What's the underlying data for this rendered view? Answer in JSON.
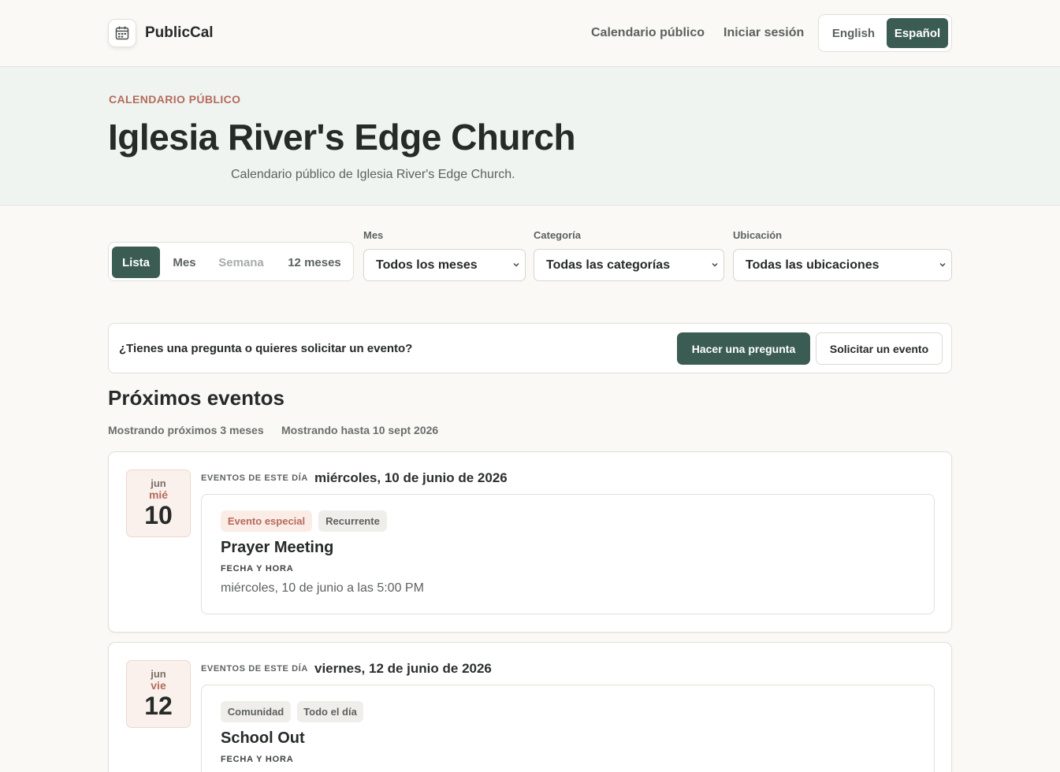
{
  "header": {
    "brand": "PublicCal",
    "nav": [
      "Calendario público",
      "Iniciar sesión"
    ],
    "languages": [
      "English",
      "Español"
    ],
    "active_language": "Español"
  },
  "hero": {
    "eyebrow": "CALENDARIO PÚBLICO",
    "title": "Iglesia River's Edge Church",
    "description": "Calendario público de Iglesia River's Edge Church."
  },
  "views": {
    "list": "Lista",
    "month": "Mes",
    "week": "Semana",
    "year": "12 meses",
    "active": "Lista"
  },
  "filters": {
    "month": {
      "label": "Mes",
      "value": "Todos los meses"
    },
    "category": {
      "label": "Categoría",
      "value": "Todas las categorías"
    },
    "location": {
      "label": "Ubicación",
      "value": "Todas las ubicaciones"
    }
  },
  "question_bar": {
    "text": "¿Tienes una pregunta o quieres solicitar un evento?",
    "ask_button": "Hacer una pregunta",
    "request_button": "Solicitar un evento"
  },
  "upcoming": {
    "title": "Próximos eventos",
    "range_note": "Mostrando próximos 3 meses",
    "until_note": "Mostrando hasta 10 sept 2026"
  },
  "days": [
    {
      "month": "jun",
      "weekday": "mié",
      "day": "10",
      "eyebrow": "EVENTOS DE ESTE DÍA",
      "date_long": "miércoles, 10 de junio de 2026",
      "event": {
        "tags": [
          "Evento especial",
          "Recurrente"
        ],
        "title": "Prayer Meeting",
        "datetime_label": "FECHA Y HORA",
        "datetime": "miércoles, 10 de junio a las 5:00 PM"
      }
    },
    {
      "month": "jun",
      "weekday": "vie",
      "day": "12",
      "eyebrow": "EVENTOS DE ESTE DÍA",
      "date_long": "viernes, 12 de junio de 2026",
      "event": {
        "tags": [
          "Comunidad",
          "Todo el día"
        ],
        "title": "School Out",
        "datetime_label": "FECHA Y HORA"
      }
    }
  ],
  "colors": {
    "primary": "#3b5c52",
    "accent": "#b56b5c",
    "background": "#faf9f6",
    "hero_background": "#eff4f0"
  }
}
